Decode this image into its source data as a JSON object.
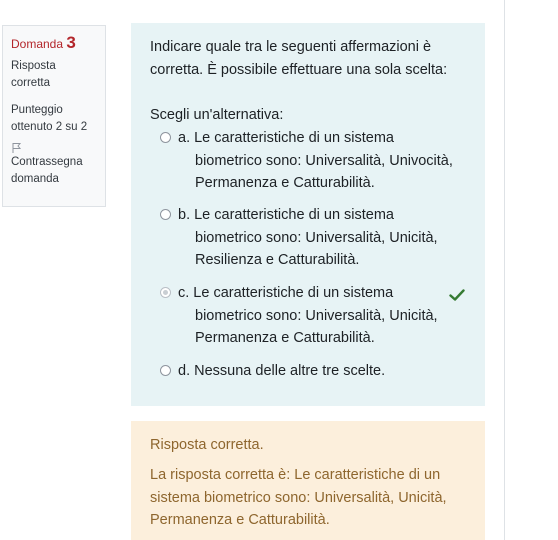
{
  "info": {
    "question_label": "Domanda",
    "question_number": "3",
    "state": "Risposta corretta",
    "grade": "Punteggio ottenuto 2 su 2",
    "flag_label": "Contrassegna domanda"
  },
  "question": {
    "text": "Indicare quale tra le seguenti affermazioni è corretta. È possibile effettuare una sola scelta:",
    "prompt": "Scegli un'alternativa:",
    "options": [
      {
        "label": "a. Le caratteristiche di un sistema biometrico sono: Universalità, Univocità, Permanenza e Catturabilità.",
        "selected": false
      },
      {
        "label": "b. Le caratteristiche di un sistema biometrico sono: Universalità, Unicità, Resilienza e Catturabilità.",
        "selected": false
      },
      {
        "label": "c. Le caratteristiche di un sistema biometrico sono: Universalità, Unicità, Permanenza e Catturabilità.",
        "selected": true,
        "correct": true
      },
      {
        "label": "d. Nessuna delle altre tre scelte.",
        "selected": false
      }
    ]
  },
  "feedback": {
    "status": "Risposta corretta.",
    "right_answer": "La risposta corretta è: Le caratteristiche di un sistema biometrico sono: Universalità, Unicità, Permanenza e Catturabilità."
  },
  "colors": {
    "formulation_bg": "#e7f3f5",
    "feedback_bg": "#fcefdc",
    "feedback_text": "#8e662e",
    "correct_check": "#357a32",
    "question_number": "#b3262b"
  }
}
